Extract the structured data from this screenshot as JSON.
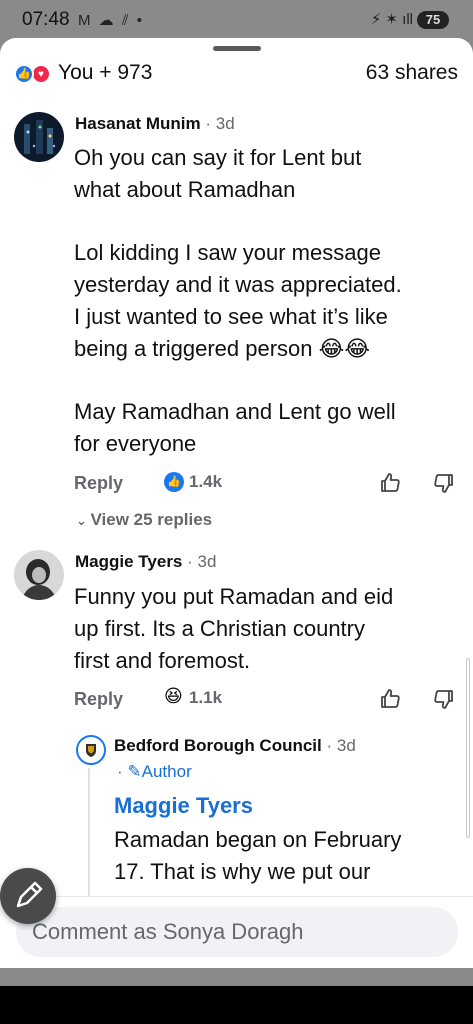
{
  "status_bar": {
    "time": "07:48",
    "left_icons": "M ☁ ⫽ •",
    "right_icons": "⚡ ✶ ıll",
    "battery": "75"
  },
  "header": {
    "reactions_label": "You + 973",
    "shares_label": "63 shares"
  },
  "comments": [
    {
      "author": "Hasanat Munim",
      "time": " · 3d",
      "text": "Oh you can say it for Lent but\nwhat about Ramadhan\n\nLol kidding I saw your message\nyesterday and it was appreciated.\nI just wanted to see what it’s like\nbeing a triggered person 😂😂\n\nMay Ramadhan and Lent go well\nfor everyone",
      "reply_label": "Reply",
      "reaction_count": "1.4k",
      "view_replies": "View 25 replies"
    },
    {
      "author": "Maggie Tyers",
      "time": " · 3d",
      "text": "Funny you put Ramadan and eid\nup first.  Its a Christian country\nfirst and foremost.",
      "reply_label": "Reply",
      "reaction_count": "1.1k"
    }
  ],
  "reply": {
    "author": "Bedford Borough Council",
    "time": " · 3d",
    "badge": "Author",
    "mention": "Maggie Tyers",
    "text_line1": "Ramadan began on February",
    "text_line2": "17. That is why we put our"
  },
  "composer": {
    "placeholder": "Comment as Sonya Doragh"
  },
  "colors": {
    "accent": "#1877f2",
    "link": "#1a6fd6",
    "love": "#f0284a",
    "muted_text": "#65676b"
  }
}
